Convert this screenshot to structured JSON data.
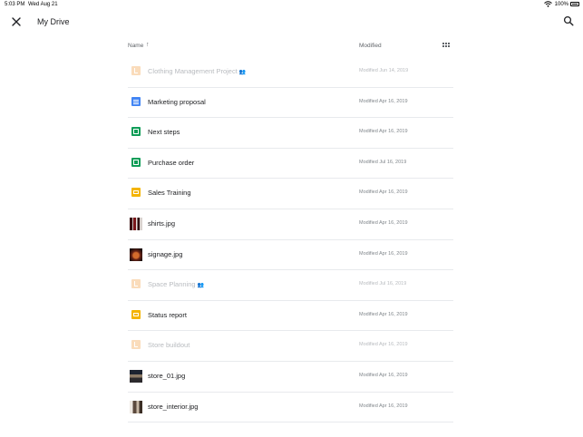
{
  "status_bar": {
    "time": "5:03 PM",
    "date": "Wed Aug 21",
    "battery": "100%"
  },
  "toolbar": {
    "title": "My Drive",
    "close_icon": "close-icon",
    "search_icon": "search-icon"
  },
  "columns": {
    "name": "Name",
    "sort_arrow": "↑",
    "modified": "Modified",
    "view_toggle_icon": "grid-view-icon"
  },
  "files": [
    {
      "name": "Clothing Management Project",
      "modified": "Modified Jun 14, 2019",
      "icon": "folder-icon",
      "dim": true,
      "shared": true
    },
    {
      "name": "Marketing proposal",
      "modified": "Modified Apr 16, 2019",
      "icon": "doc-icon",
      "dim": false,
      "shared": false
    },
    {
      "name": "Next steps",
      "modified": "Modified Apr 16, 2019",
      "icon": "sheet-icon",
      "dim": false,
      "shared": false
    },
    {
      "name": "Purchase order",
      "modified": "Modified Jul 16, 2019",
      "icon": "sheet-icon",
      "dim": false,
      "shared": false
    },
    {
      "name": "Sales Training",
      "modified": "Modified Apr 16, 2019",
      "icon": "slide-icon",
      "dim": false,
      "shared": false
    },
    {
      "name": "shirts.jpg",
      "modified": "Modified Apr 16, 2019",
      "icon": "image-thumbnail",
      "dim": false,
      "shared": false
    },
    {
      "name": "signage.jpg",
      "modified": "Modified Apr 16, 2019",
      "icon": "image-thumbnail",
      "dim": false,
      "shared": false
    },
    {
      "name": "Space Planning",
      "modified": "Modified Jul 16, 2019",
      "icon": "folder-icon",
      "dim": true,
      "shared": true
    },
    {
      "name": "Status report",
      "modified": "Modified Apr 16, 2019",
      "icon": "slide-icon",
      "dim": false,
      "shared": false
    },
    {
      "name": "Store buildout",
      "modified": "Modified Apr 16, 2019",
      "icon": "folder-icon",
      "dim": true,
      "shared": false
    },
    {
      "name": "store_01.jpg",
      "modified": "Modified Apr 16, 2019",
      "icon": "image-thumbnail",
      "dim": false,
      "shared": false
    },
    {
      "name": "store_interior.jpg",
      "modified": "Modified Apr 16, 2019",
      "icon": "image-thumbnail",
      "dim": false,
      "shared": false
    }
  ]
}
